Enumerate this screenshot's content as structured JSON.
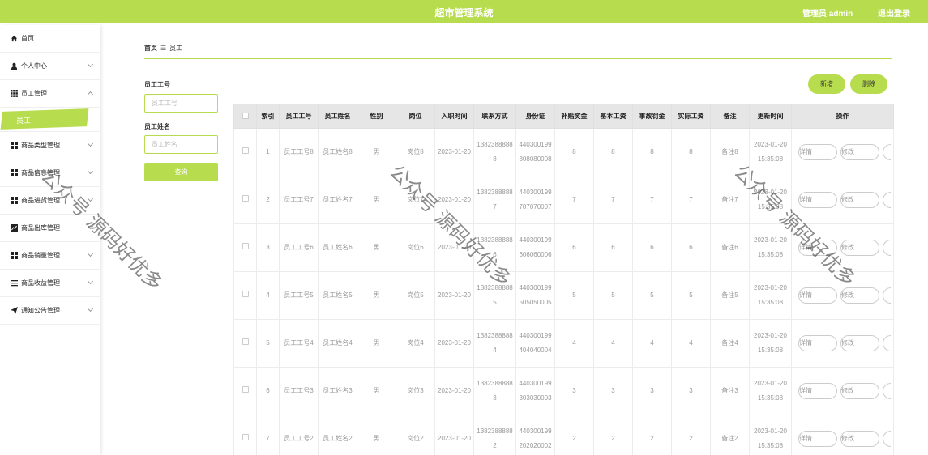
{
  "header": {
    "title": "超市管理系统",
    "admin": "管理员 admin",
    "logout": "退出登录"
  },
  "sidebar": {
    "items": [
      {
        "label": "首页",
        "icon": "home-icon"
      },
      {
        "label": "个人中心",
        "icon": "user-icon"
      },
      {
        "label": "员工管理",
        "icon": "grid-icon",
        "expanded": true
      },
      {
        "label": "商品类型管理",
        "icon": "apps-icon"
      },
      {
        "label": "商品信息管理",
        "icon": "apps-icon"
      },
      {
        "label": "商品进货管理",
        "icon": "apps-icon"
      },
      {
        "label": "商品出库管理",
        "icon": "chart-icon"
      },
      {
        "label": "商品销量管理",
        "icon": "apps-icon"
      },
      {
        "label": "商品收益管理",
        "icon": "list-icon"
      },
      {
        "label": "通知公告管理",
        "icon": "send-icon"
      }
    ],
    "submenu_active": "员工"
  },
  "breadcrumb": {
    "home": "首页",
    "separator": "☰",
    "current": "员工"
  },
  "filters": {
    "emp_no_label": "员工工号",
    "emp_no_placeholder": "员工工号",
    "emp_name_label": "员工姓名",
    "emp_name_placeholder": "员工姓名",
    "query": "查询"
  },
  "actions": {
    "add": "新增",
    "delete": "删除"
  },
  "table": {
    "headers": [
      "索引",
      "员工工号",
      "员工姓名",
      "性别",
      "岗位",
      "入职时间",
      "联系方式",
      "身份证",
      "补贴奖金",
      "基本工资",
      "事故罚金",
      "实际工资",
      "备注",
      "更新时间",
      "操作"
    ],
    "rows": [
      [
        "1",
        "员工工号8",
        "员工姓名8",
        "男",
        "岗位8",
        "2023-01-20",
        "13823888888",
        "440300199808080008",
        "8",
        "8",
        "8",
        "8",
        "备注8",
        "2023-01-20 15:35:08"
      ],
      [
        "2",
        "员工工号7",
        "员工姓名7",
        "男",
        "岗位7",
        "2023-01-20",
        "13823888887",
        "440300199707070007",
        "7",
        "7",
        "7",
        "7",
        "备注7",
        "2023-01-20 15:35:08"
      ],
      [
        "3",
        "员工工号6",
        "员工姓名6",
        "男",
        "岗位6",
        "2023-01-20",
        "13823888886",
        "440300199606060006",
        "6",
        "6",
        "6",
        "6",
        "备注6",
        "2023-01-20 15:35:08"
      ],
      [
        "4",
        "员工工号5",
        "员工姓名5",
        "男",
        "岗位5",
        "2023-01-20",
        "13823888885",
        "440300199505050005",
        "5",
        "5",
        "5",
        "5",
        "备注5",
        "2023-01-20 15:35:08"
      ],
      [
        "5",
        "员工工号4",
        "员工姓名4",
        "男",
        "岗位4",
        "2023-01-20",
        "13823888884",
        "440300199404040004",
        "4",
        "4",
        "4",
        "4",
        "备注4",
        "2023-01-20 15:35:08"
      ],
      [
        "6",
        "员工工号3",
        "员工姓名3",
        "男",
        "岗位3",
        "2023-01-20",
        "13823888883",
        "440300199303030003",
        "3",
        "3",
        "3",
        "3",
        "备注3",
        "2023-01-20 15:35:08"
      ],
      [
        "7",
        "员工工号2",
        "员工姓名2",
        "男",
        "岗位2",
        "2023-01-20",
        "13823888882",
        "440300199202020002",
        "2",
        "2",
        "2",
        "2",
        "备注2",
        "2023-01-20 15:35:08"
      ]
    ],
    "row_actions": [
      "详情",
      "修改"
    ]
  },
  "watermark": "公众号 源码好优多",
  "colors": {
    "accent": "#b7dc4e"
  }
}
